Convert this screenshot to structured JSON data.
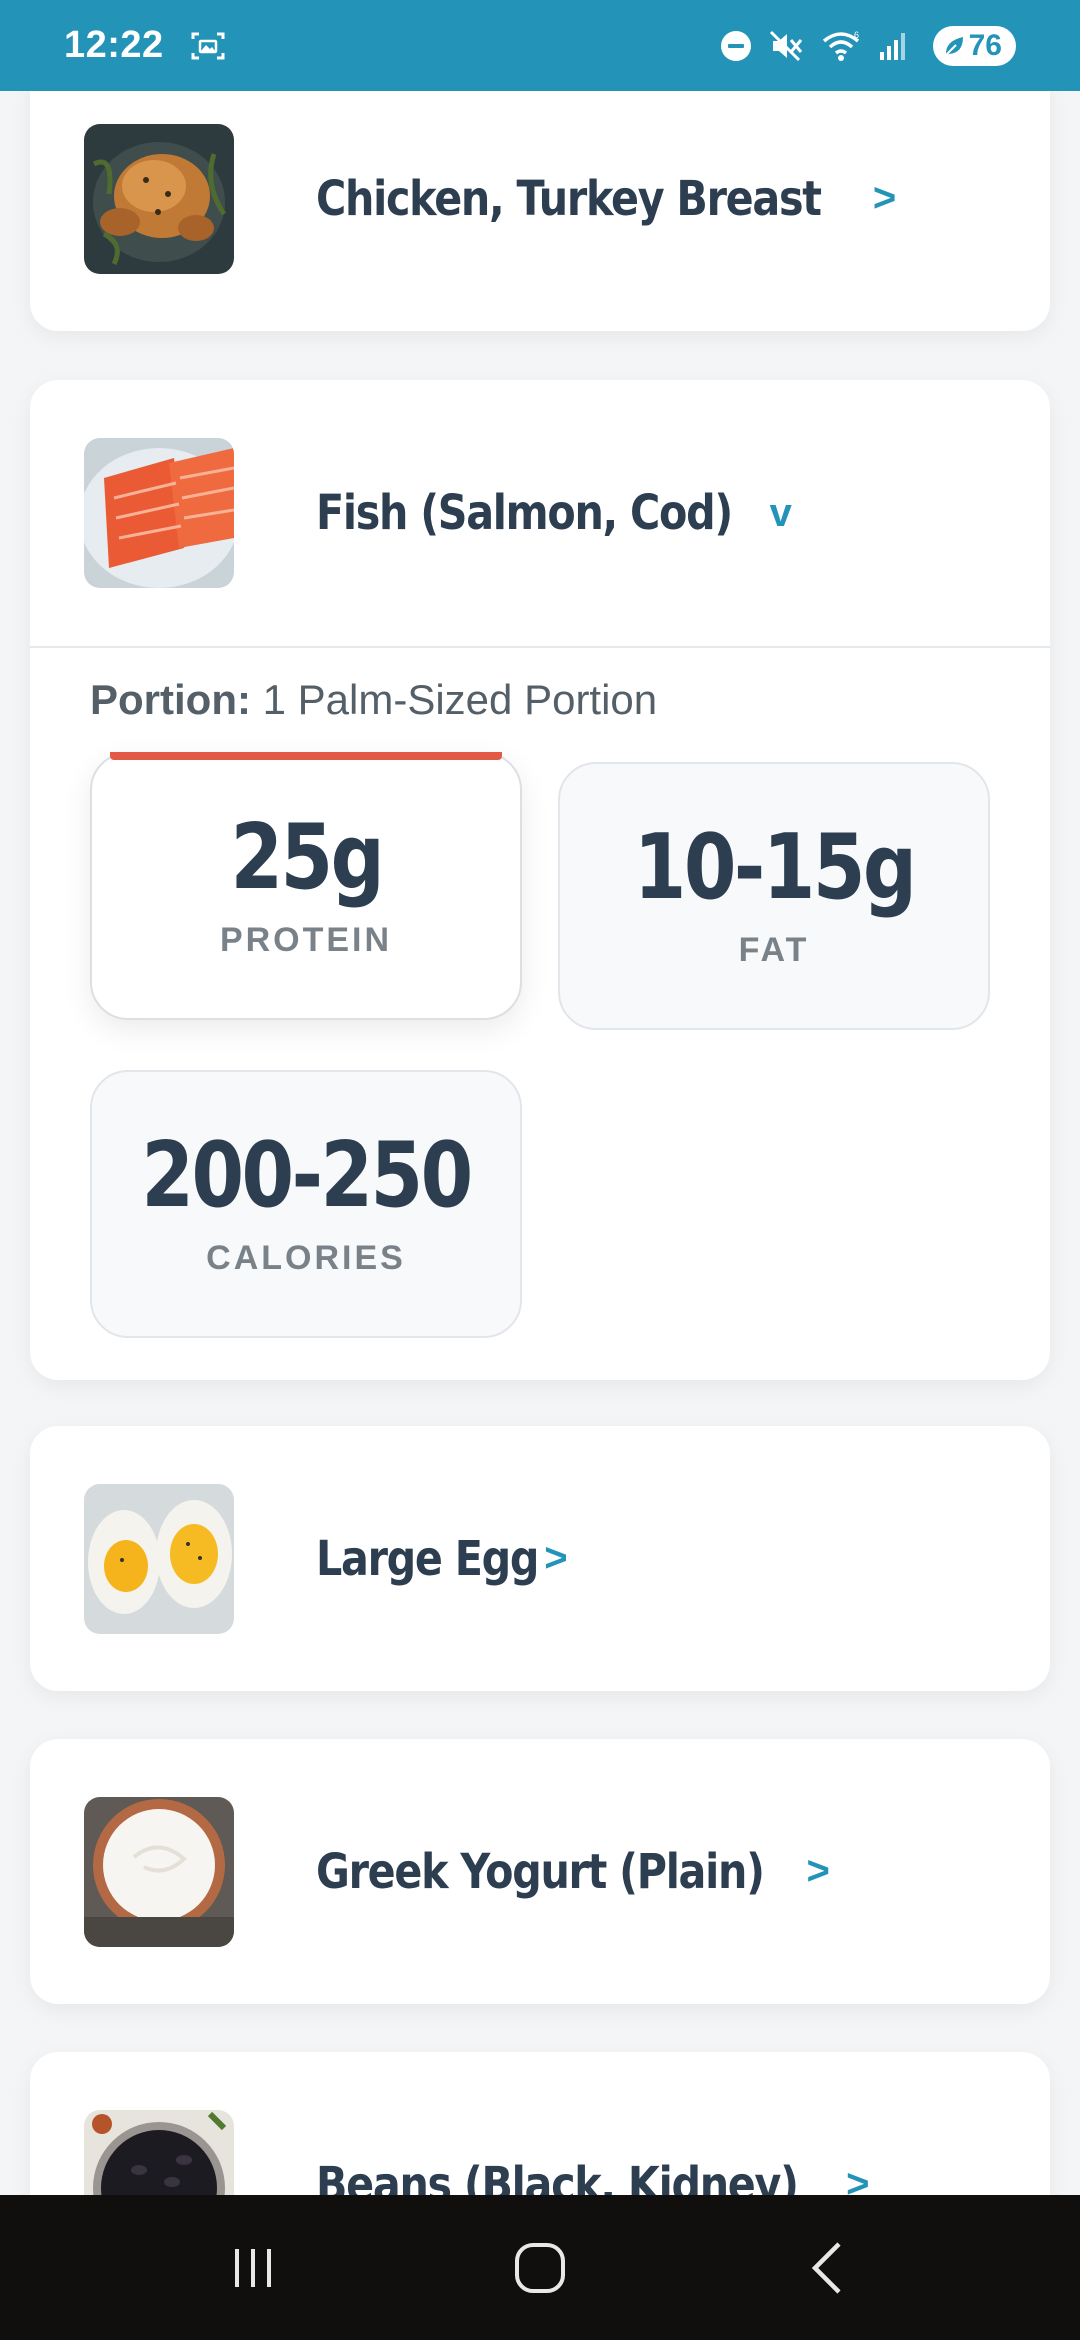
{
  "status_bar": {
    "time": "12:22",
    "battery": "76",
    "icons": [
      "screenshot-icon",
      "do-not-disturb-icon",
      "mute-icon",
      "wifi-icon",
      "signal-icon",
      "battery-saver-icon"
    ]
  },
  "colors": {
    "accent": "#2394b8",
    "text": "#2c3e50",
    "highlight": "#e25a46"
  },
  "foods": [
    {
      "name": "Chicken, Turkey Breast",
      "chevron": ">",
      "image": "roast-chicken"
    },
    {
      "name": "Fish (Salmon, Cod)",
      "chevron": "v",
      "image": "salmon-fillet",
      "expanded": true,
      "portion_label": "Portion:",
      "portion_value": " 1 Palm-Sized Portion",
      "stats": [
        {
          "value": "25g",
          "label": "PROTEIN",
          "active": true
        },
        {
          "value": "10-15g",
          "label": "FAT"
        },
        {
          "value": "200-250",
          "label": "CALORIES"
        }
      ]
    },
    {
      "name": "Large Egg",
      "chevron": ">",
      "image": "boiled-egg"
    },
    {
      "name": "Greek Yogurt (Plain)",
      "chevron": ">",
      "image": "greek-yogurt"
    },
    {
      "name": "Beans (Black, Kidney)",
      "chevron": ">",
      "image": "black-beans"
    }
  ],
  "nav_bar": [
    "recent-apps-button",
    "home-button",
    "back-button"
  ]
}
